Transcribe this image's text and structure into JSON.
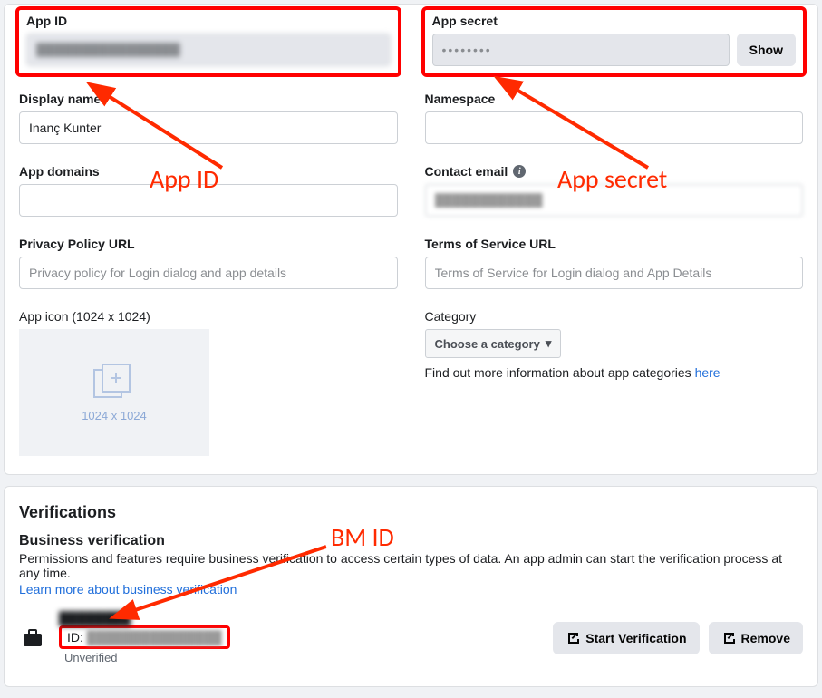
{
  "appId": {
    "label": "App ID",
    "value": "████████████████"
  },
  "appSecret": {
    "label": "App secret",
    "value": "••••••••",
    "showBtn": "Show"
  },
  "displayName": {
    "label": "Display name",
    "value": "Inanç Kunter"
  },
  "namespaceField": {
    "label": "Namespace",
    "value": ""
  },
  "appDomains": {
    "label": "App domains",
    "value": ""
  },
  "contactEmail": {
    "label": "Contact email",
    "value": "████████████"
  },
  "privacyPolicy": {
    "label": "Privacy Policy URL",
    "placeholder": "Privacy policy for Login dialog and app details"
  },
  "tos": {
    "label": "Terms of Service URL",
    "placeholder": "Terms of Service for Login dialog and App Details"
  },
  "appIcon": {
    "label": "App icon (1024 x 1024)",
    "placeholderText": "1024 x 1024"
  },
  "category": {
    "label": "Category",
    "button": "Choose a category",
    "helperPrefix": "Find out more information about app categories ",
    "helperLink": "here"
  },
  "verifications": {
    "heading": "Verifications",
    "subheading": "Business verification",
    "desc": "Permissions and features require business verification to access certain types of data. An app admin can start the verification process at any time.",
    "learnMore": "Learn more about business verification",
    "bizName": "████████",
    "idLabel": "ID:",
    "idValue": "███████████████",
    "status": "Unverified",
    "startBtn": "Start Verification",
    "removeBtn": "Remove"
  },
  "annotations": {
    "appId": "App ID",
    "appSecret": "App secret",
    "bmId": "BM ID"
  }
}
